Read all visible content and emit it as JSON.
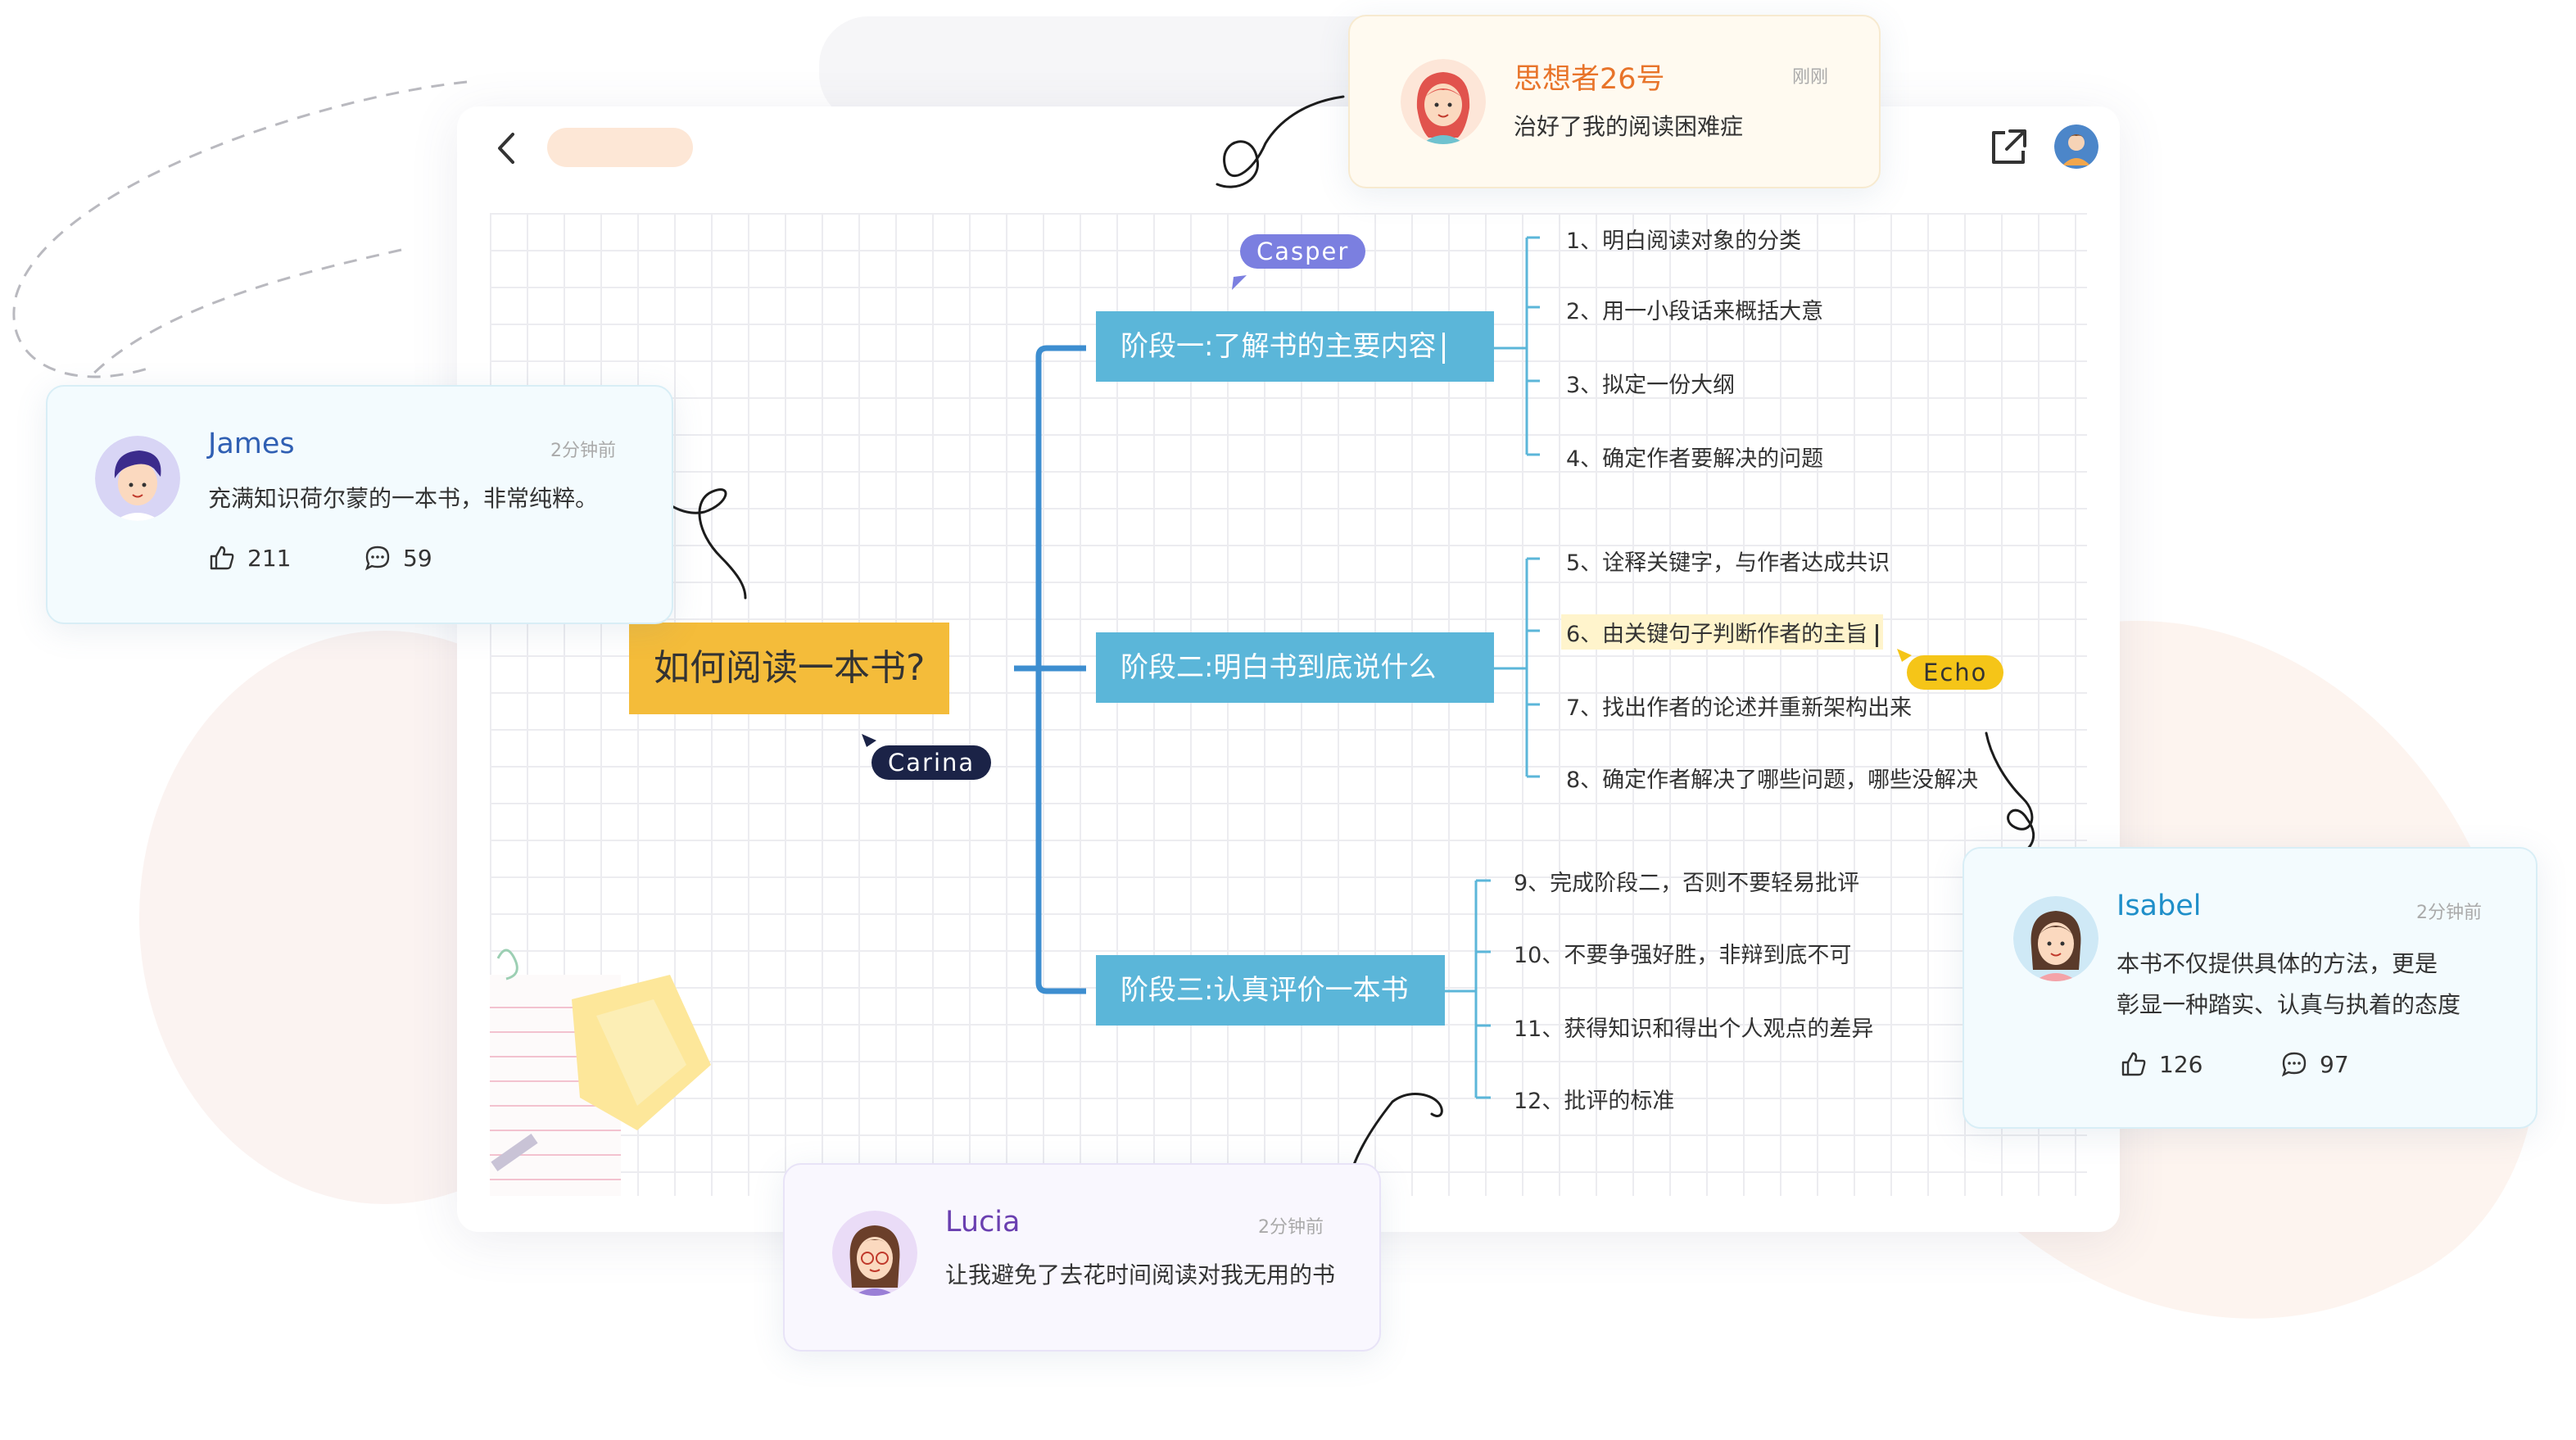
{
  "mindmap": {
    "root": "如何阅读一本书?",
    "stages": [
      {
        "label": "阶段一:了解书的主要内容",
        "items": [
          "1、明白阅读对象的分类",
          "2、用一小段话来概括大意",
          "3、拟定一份大纲",
          "4、确定作者要解决的问题"
        ]
      },
      {
        "label": "阶段二:明白书到底说什么",
        "items": [
          "5、诠释关键字，与作者达成共识",
          "6、由关键句子判断作者的主旨",
          "7、找出作者的论述并重新架构出来",
          "8、确定作者解决了哪些问题，哪些没解决"
        ]
      },
      {
        "label": "阶段三:认真评价一本书",
        "items": [
          "9、完成阶段二，否则不要轻易批评",
          "10、不要争强好胜，非辩到底不可",
          "11、获得知识和得出个人观点的差异",
          "12、批评的标准"
        ]
      }
    ]
  },
  "cursors": {
    "casper": "Casper",
    "carina": "Carina",
    "echo": "Echo"
  },
  "comments": {
    "thinker": {
      "name": "思想者26号",
      "time": "刚刚",
      "text": "治好了我的阅读困难症"
    },
    "james": {
      "name": "James",
      "time": "2分钟前",
      "text": "充满知识荷尔蒙的一本书，非常纯粹。",
      "likes": "211",
      "replies": "59"
    },
    "isabel": {
      "name": "Isabel",
      "time": "2分钟前",
      "text1": "本书不仅提供具体的方法，更是",
      "text2": "彰显一种踏实、认真与执着的态度",
      "likes": "126",
      "replies": "97"
    },
    "lucia": {
      "name": "Lucia",
      "time": "2分钟前",
      "text": "让我避免了去花时间阅读对我无用的书"
    }
  },
  "colors": {
    "root": "#f4bc3a",
    "stage": "#5bb6d9",
    "branch": "#3d8ed0",
    "leaf_line": "#5bb6d9",
    "accent_orange": "#e8742a",
    "accent_blue": "#2f5fb3",
    "accent_purple": "#6a3fb0"
  },
  "icons": [
    "back-icon",
    "share-icon",
    "like-icon",
    "comment-icon"
  ]
}
